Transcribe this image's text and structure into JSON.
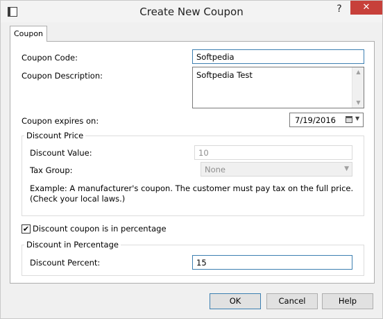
{
  "window": {
    "title": "Create New Coupon",
    "help_glyph": "?",
    "close_glyph": "✕"
  },
  "tabs": [
    {
      "label": "Coupon"
    }
  ],
  "form": {
    "coupon_code_label": "Coupon Code:",
    "coupon_code_value": "Softpedia",
    "coupon_description_label": "Coupon Description:",
    "coupon_description_value": "Softpedia Test",
    "expires_label": "Coupon expires on:",
    "expires_value": "7/19/2016",
    "discount_price": {
      "group_label": "Discount Price",
      "value_label": "Discount Value:",
      "value": "10",
      "tax_group_label": "Tax Group:",
      "tax_group_value": "None",
      "example_text": "Example: A manufacturer's coupon.  The customer must pay tax on the full price.  (Check your local laws.)"
    },
    "percentage_checkbox_label": "Discount coupon is in percentage",
    "percentage_checked": true,
    "discount_percentage": {
      "group_label": "Discount in Percentage",
      "percent_label": "Discount Percent:",
      "percent_value": "15"
    }
  },
  "buttons": {
    "ok": "OK",
    "cancel": "Cancel",
    "help": "Help"
  },
  "icons": [
    "app-icon",
    "help-icon",
    "close-icon",
    "calendar-icon",
    "chevron-down-icon",
    "checkmark-icon"
  ]
}
